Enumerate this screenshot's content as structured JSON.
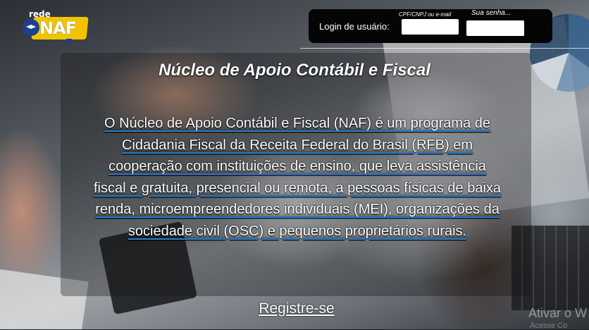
{
  "brand": {
    "small": "rede",
    "name": "NAF"
  },
  "login": {
    "label": "Login de usuário:",
    "user_hint": "CPF/CNPJ ou e-mail",
    "password_hint": "Sua senha..."
  },
  "main": {
    "title": "Núcleo de Apoio Contábil e Fiscal",
    "description": "O Núcleo de Apoio Contábil e Fiscal (NAF) é um programa de Cidadania Fiscal da Receita Federal do Brasil (RFB) em cooperação com instituições de ensino, que leva assistência fiscal e gratuita, presencial ou remota, a pessoas físicas de baixa renda, microempreendedores individuais (MEI), organizações da sociedade civil (OSC) e pequenos proprietários rurais.",
    "register_link": "Registre-se"
  },
  "watermark": {
    "line1": "Ativar o W",
    "line2": "Acesse Co"
  },
  "colors": {
    "accent_yellow": "#f2c400",
    "accent_blue": "#1d3f8f",
    "underline_blue": "#2a7fd0"
  }
}
